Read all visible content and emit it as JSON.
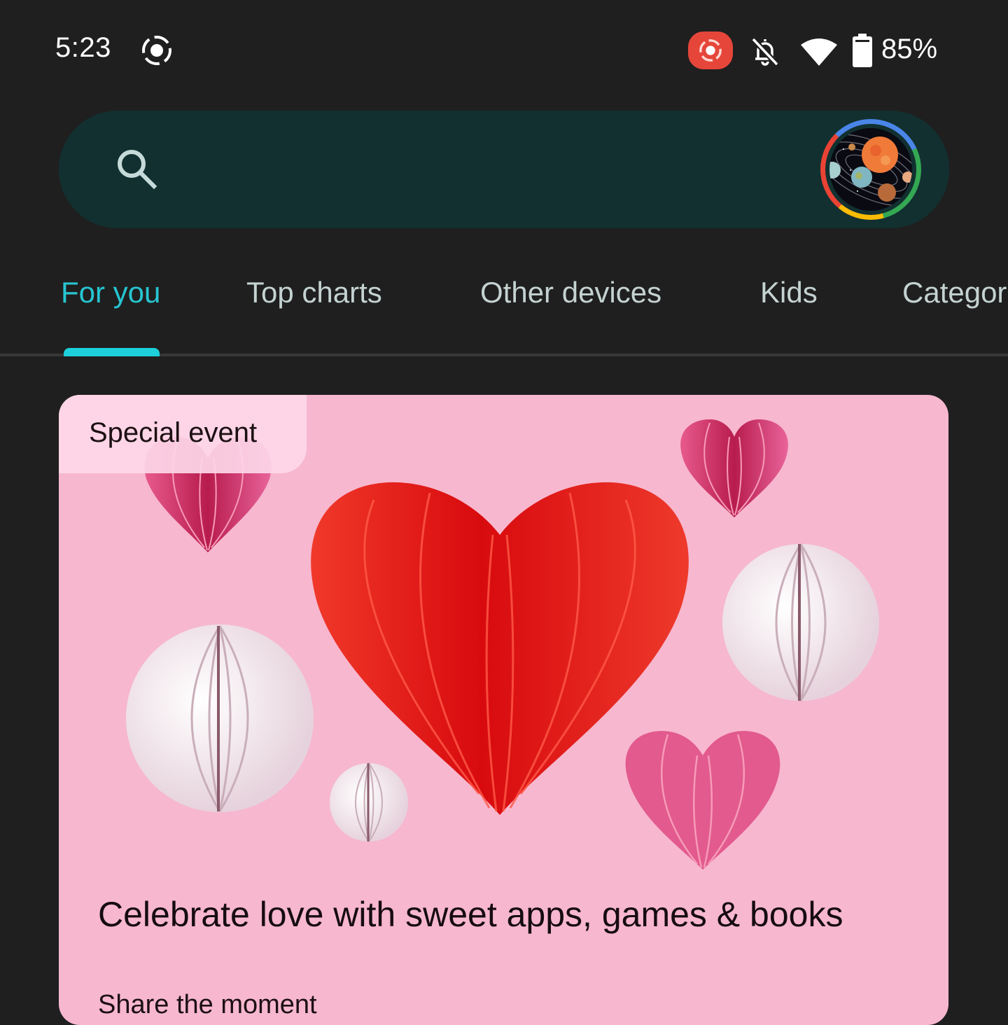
{
  "status_bar": {
    "time": "5:23",
    "icons": [
      "screen-record-icon",
      "cast-recording-icon",
      "notifications-off-icon",
      "wifi-icon",
      "battery-icon"
    ],
    "battery_percent": "85%",
    "cast_badge_color": "#e6463a"
  },
  "search": {
    "placeholder": "",
    "value": "",
    "icon": "search-icon",
    "avatar_icon": "account-avatar"
  },
  "tabs": [
    {
      "label": "For you",
      "active": true
    },
    {
      "label": "Top charts",
      "active": false
    },
    {
      "label": "Other devices",
      "active": false
    },
    {
      "label": "Kids",
      "active": false
    },
    {
      "label": "Categories",
      "active": false
    }
  ],
  "tab_visible_labels": [
    "For you",
    "Top charts",
    "Other devices",
    "Kids",
    "Categor"
  ],
  "colors": {
    "background": "#1f1f1f",
    "search_bar": "#123030",
    "accent": "#27c5d1",
    "card_background": "#f7b7cf",
    "badge_background": "#fdd7e8"
  },
  "featured_card": {
    "badge": "Special event",
    "title": "Celebrate love with sweet apps, games & books",
    "subtitle": "Share the moment",
    "image": "paper-hearts-illustration"
  }
}
